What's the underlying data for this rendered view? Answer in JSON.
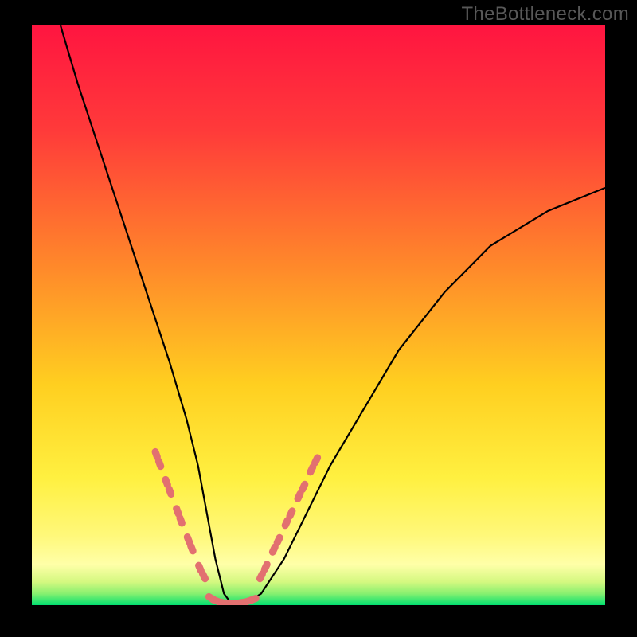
{
  "watermark": "TheBottleneck.com",
  "colors": {
    "page_bg": "#000000",
    "gradient_top": "#ff1a3a",
    "gradient_mid": "#ffd400",
    "gradient_bottom": "#00e06a",
    "curve_stroke": "#000000",
    "marker_fill": "#e27070",
    "watermark_text": "#585858"
  },
  "chart_data": {
    "type": "line",
    "title": "",
    "xlabel": "",
    "ylabel": "",
    "xlim": [
      0,
      100
    ],
    "ylim": [
      0,
      100
    ],
    "grid": false,
    "legend": false,
    "series": [
      {
        "name": "bottleneck-curve",
        "x": [
          5,
          8,
          12,
          16,
          20,
          24,
          27,
          29,
          30.5,
          32,
          33.5,
          35,
          37,
          40,
          44,
          48,
          52,
          58,
          64,
          72,
          80,
          90,
          100
        ],
        "y": [
          100,
          90,
          78,
          66,
          54,
          42,
          32,
          24,
          16,
          8,
          2,
          0,
          0,
          2,
          8,
          16,
          24,
          34,
          44,
          54,
          62,
          68,
          72
        ]
      }
    ],
    "markers": {
      "left_cluster_x": [
        21.7,
        22.3,
        23.5,
        24.1,
        25.4,
        26.0,
        27.3,
        27.9,
        29.3,
        30.0
      ],
      "left_cluster_y": [
        26.0,
        24.4,
        21.2,
        19.6,
        16.2,
        14.6,
        11.3,
        9.8,
        6.4,
        5.0
      ],
      "bridge_x": [
        31.3,
        32.0,
        33.4,
        34.2,
        35.6,
        36.4,
        37.8,
        38.6
      ],
      "bridge_y": [
        1.2,
        0.8,
        0.4,
        0.3,
        0.3,
        0.4,
        0.7,
        1.0
      ],
      "right_cluster_x": [
        40.0,
        40.8,
        42.2,
        43.0,
        44.4,
        45.2,
        46.6,
        47.4,
        48.8,
        49.6
      ],
      "right_cluster_y": [
        5.0,
        6.6,
        9.6,
        11.2,
        14.2,
        15.8,
        18.8,
        20.4,
        23.4,
        25.0
      ]
    },
    "gradient_bands_y": [
      {
        "from": 0,
        "to": 2,
        "color": "#00e06a"
      },
      {
        "from": 2,
        "to": 6,
        "color": "#b6f05a"
      },
      {
        "from": 6,
        "to": 14,
        "color": "#fff070"
      },
      {
        "from": 14,
        "to": 50,
        "color": "#ffd400"
      },
      {
        "from": 50,
        "to": 80,
        "color": "#ff7a30"
      },
      {
        "from": 80,
        "to": 100,
        "color": "#ff1a3a"
      }
    ]
  }
}
